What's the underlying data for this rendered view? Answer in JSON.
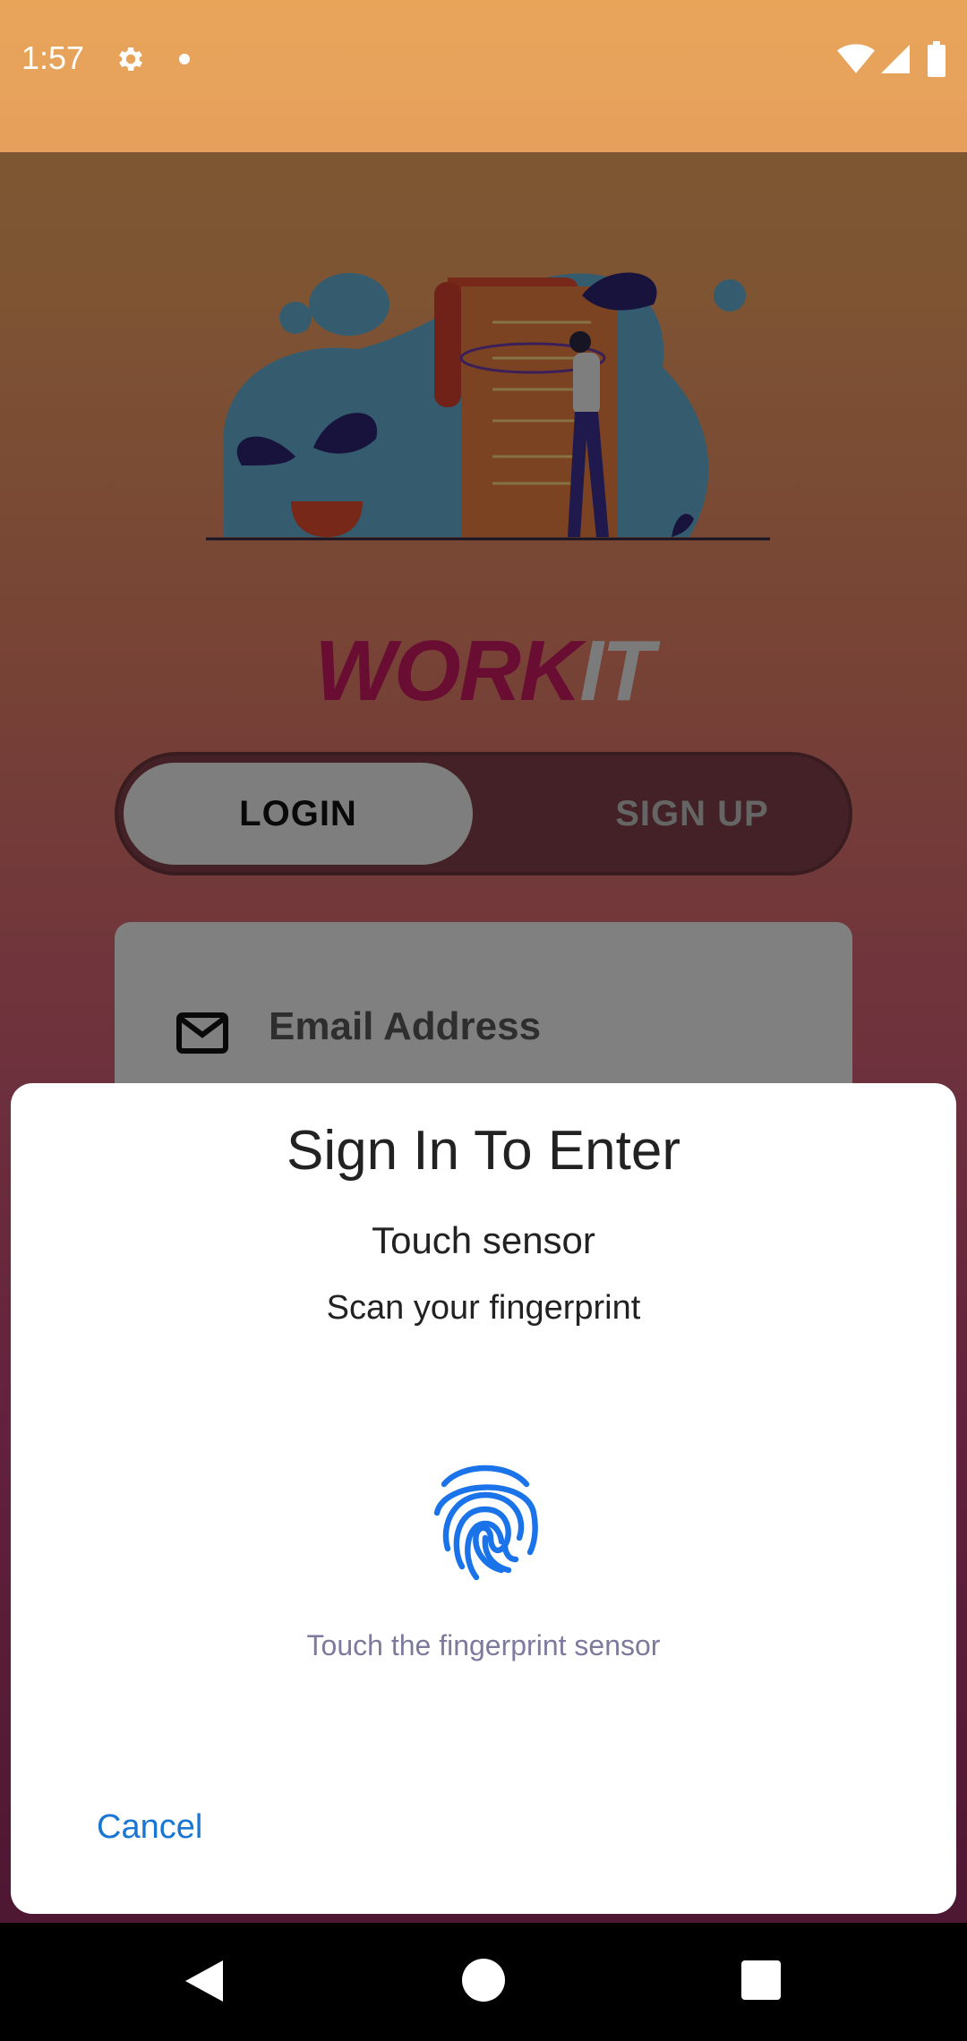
{
  "status_bar": {
    "time": "1:57",
    "icons": [
      "gear-icon",
      "dot-icon",
      "wifi-icon",
      "signal-icon",
      "battery-icon"
    ]
  },
  "app": {
    "brand_part1": "WORK",
    "brand_part2": "IT",
    "tabs": [
      {
        "label": "LOGIN",
        "selected": true
      },
      {
        "label": "SIGN UP",
        "selected": false
      }
    ],
    "email_placeholder": "Email Address"
  },
  "dialog": {
    "title": "Sign In To Enter",
    "subtitle": "Touch sensor",
    "description": "Scan your fingerprint",
    "hint": "Touch the fingerprint sensor",
    "cancel_label": "Cancel"
  },
  "colors": {
    "brand_primary": "#c2185b",
    "accent": "#1976d2",
    "hint": "#7d7a9e"
  },
  "nav_bar": {
    "icons": [
      "back-icon",
      "home-icon",
      "recents-icon"
    ]
  }
}
